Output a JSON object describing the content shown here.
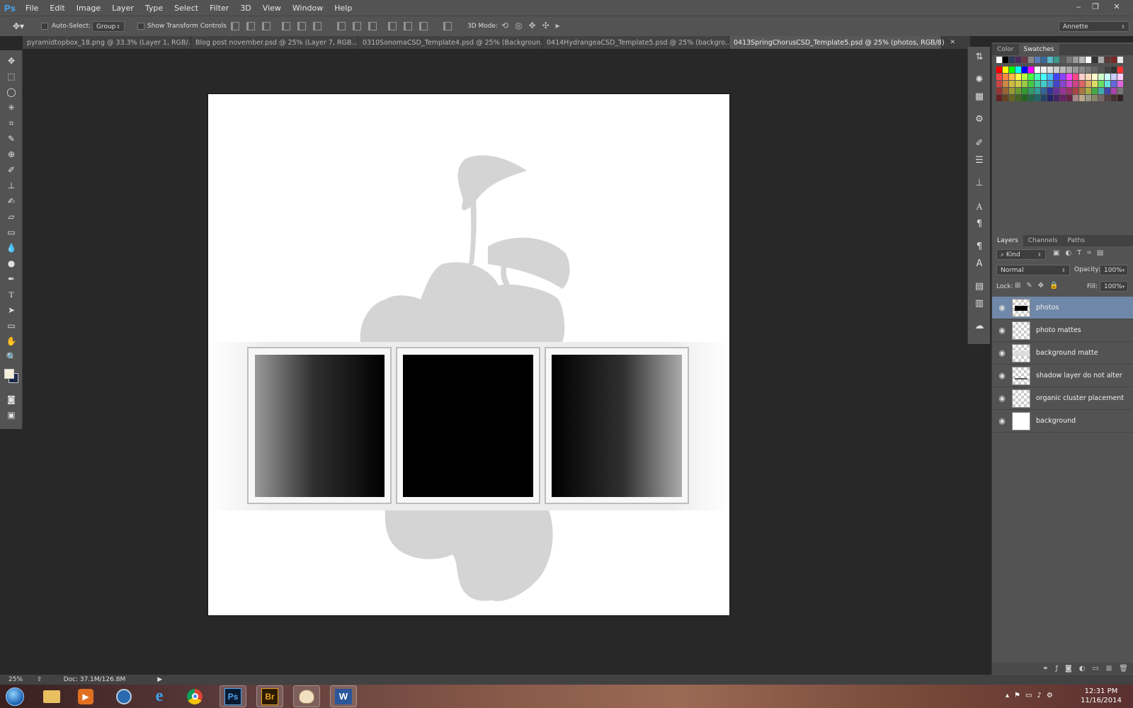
{
  "app": {
    "logo": "Ps"
  },
  "menu": [
    "File",
    "Edit",
    "Image",
    "Layer",
    "Type",
    "Select",
    "Filter",
    "3D",
    "View",
    "Window",
    "Help"
  ],
  "window_controls": {
    "minimize": "‒",
    "restore": "❐",
    "close": "✕"
  },
  "options_bar": {
    "auto_select_label": "Auto-Select:",
    "auto_select_value": "Group",
    "show_transform_label": "Show Transform Controls",
    "mode_3d_label": "3D Mode:",
    "workspace": "Annette"
  },
  "tabs": [
    {
      "label": "pyramidtopbox_18.png @ 33.3% (Layer 1, RGB/...",
      "active": false
    },
    {
      "label": "Blog post november.psd @ 25% (Layer 7, RGB...",
      "active": false
    },
    {
      "label": "0310SonomaCSD_Template4.psd @ 25% (Backgroun...",
      "active": false
    },
    {
      "label": "0414HydrangeaCSD_Template5.psd @ 25% (backgro...",
      "active": false
    },
    {
      "label": "0413SpringChorusCSD_Template5.psd @ 25% (photos, RGB/8)",
      "active": true
    }
  ],
  "color_panel": {
    "tabs": [
      "Color",
      "Swatches"
    ],
    "active": "Swatches"
  },
  "layers_panel": {
    "tabs": [
      "Layers",
      "Channels",
      "Paths"
    ],
    "filter": "Kind",
    "blend_mode": "Normal",
    "opacity_label": "Opacity:",
    "opacity": "100%",
    "lock_label": "Lock:",
    "fill_label": "Fill:",
    "fill": "100%",
    "layers": [
      {
        "name": "photos",
        "selected": true
      },
      {
        "name": "photo mattes",
        "selected": false
      },
      {
        "name": "background matte",
        "selected": false
      },
      {
        "name": "shadow layer do not alter",
        "selected": false
      },
      {
        "name": "organic cluster placement",
        "selected": false
      },
      {
        "name": "background",
        "selected": false
      }
    ]
  },
  "status": {
    "zoom": "25%",
    "doc": "Doc: 37.1M/126.8M"
  },
  "taskbar": {
    "apps": [
      "start-orb",
      "file-explorer",
      "media-player",
      "network",
      "internet-explorer",
      "chrome",
      "photoshop",
      "bridge",
      "paint",
      "word"
    ],
    "photoshop_label": "Ps",
    "bridge_label": "Br",
    "word_label": "W",
    "time": "12:31 PM",
    "date": "11/16/2014"
  },
  "colors": {
    "accent": "#6f87a8",
    "panel": "#535353",
    "canvas_bg": "#282828"
  }
}
